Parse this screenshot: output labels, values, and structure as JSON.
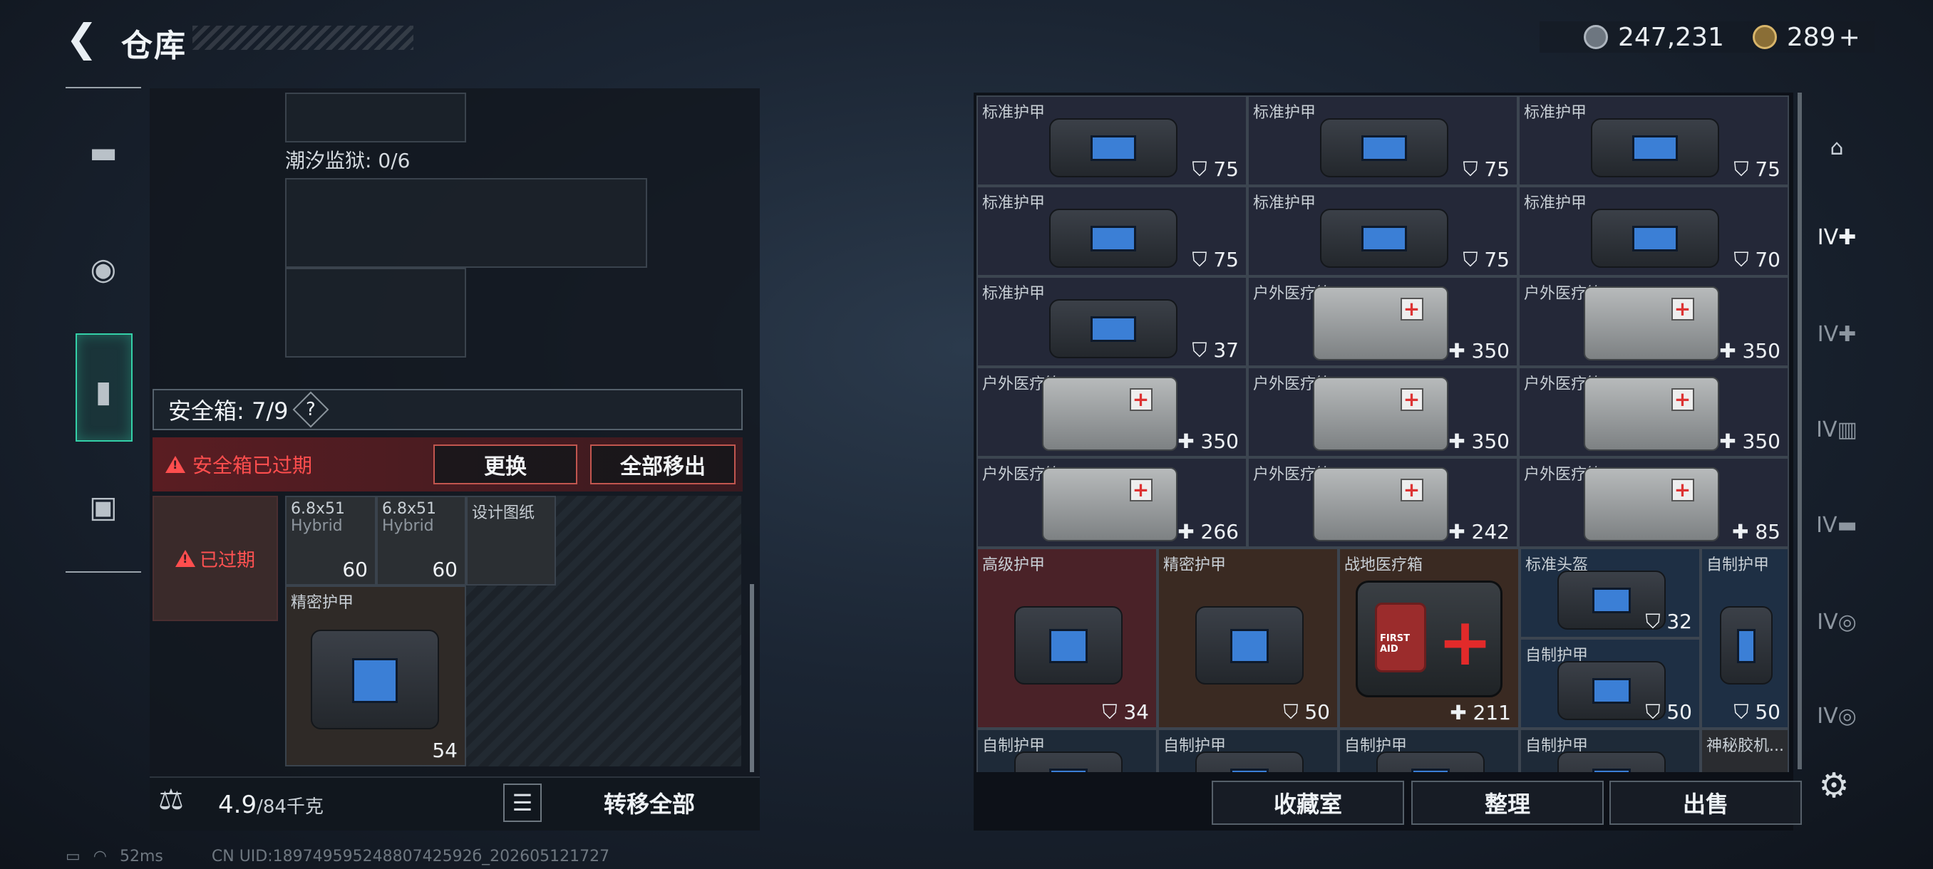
{
  "header": {
    "back_icon": "back-arrow-icon",
    "title": "仓库"
  },
  "currency": {
    "coins": "247,231",
    "premium": "289",
    "premium_plus": "+"
  },
  "left_nav": {
    "items": [
      "weapon-icon",
      "armor-icon",
      "safebox-icon",
      "toolbox-icon"
    ],
    "active": "safebox-icon"
  },
  "prison": {
    "label": "潮汐监狱: 0/6"
  },
  "safebox": {
    "label": "安全箱: 7/9",
    "help": "?",
    "expired_text": "安全箱已过期",
    "replace_label": "更换",
    "remove_all_label": "全部移出",
    "badge_text": "已过期",
    "items": [
      {
        "name": "6.8x51",
        "tag": "Hybrid",
        "count": "60"
      },
      {
        "name": "6.8x51",
        "tag": "Hybrid",
        "count": "60"
      },
      {
        "name": "设计图纸",
        "tag": "",
        "count": ""
      },
      {
        "name": "精密护甲",
        "tag": "",
        "count": "54"
      }
    ]
  },
  "weight": {
    "value": "4.9",
    "unit": "/84千克"
  },
  "transfer_all_label": "转移全部",
  "status": {
    "ping": "52ms",
    "uid": "CN UID:18974959524880742592б_202605121727"
  },
  "stash": {
    "items": [
      {
        "name": "标准护甲",
        "value": "75",
        "kind": "armor"
      },
      {
        "name": "标准护甲",
        "value": "75",
        "kind": "armor"
      },
      {
        "name": "标准护甲",
        "value": "75",
        "kind": "armor"
      },
      {
        "name": "标准护甲",
        "value": "75",
        "kind": "armor"
      },
      {
        "name": "标准护甲",
        "value": "75",
        "kind": "armor"
      },
      {
        "name": "标准护甲",
        "value": "70",
        "kind": "armor"
      },
      {
        "name": "标准护甲",
        "value": "37",
        "kind": "armor"
      },
      {
        "name": "户外医疗箱",
        "value": "350",
        "kind": "medkit"
      },
      {
        "name": "户外医疗箱",
        "value": "350",
        "kind": "medkit"
      },
      {
        "name": "户外医疗箱",
        "value": "350",
        "kind": "medkit"
      },
      {
        "name": "户外医疗箱",
        "value": "350",
        "kind": "medkit"
      },
      {
        "name": "户外医疗箱",
        "value": "350",
        "kind": "medkit"
      },
      {
        "name": "户外医疗箱",
        "value": "266",
        "kind": "medkit"
      },
      {
        "name": "户外医疗箱",
        "value": "242",
        "kind": "medkit"
      },
      {
        "name": "户外医疗箱",
        "value": "85",
        "kind": "medkit"
      },
      {
        "name": "高级护甲",
        "value": "34",
        "kind": "armor"
      },
      {
        "name": "精密护甲",
        "value": "50",
        "kind": "armor"
      },
      {
        "name": "战地医疗箱",
        "value": "211",
        "kind": "firstaid"
      },
      {
        "name": "标准头盔",
        "value": "32",
        "kind": "helmet"
      },
      {
        "name": "自制护甲",
        "value": "50",
        "kind": "armor"
      },
      {
        "name": "自制护甲",
        "value": "50",
        "kind": "armor"
      },
      {
        "name": "自制护甲",
        "value": "",
        "kind": "armor"
      },
      {
        "name": "自制护甲",
        "value": "",
        "kind": "armor"
      },
      {
        "name": "自制护甲",
        "value": "",
        "kind": "armor"
      },
      {
        "name": "自制护甲",
        "value": "",
        "kind": "armor"
      },
      {
        "name": "神秘胶机...",
        "value": "",
        "kind": "misc"
      }
    ]
  },
  "first_aid_label": "FIRST AID",
  "filters": {
    "tier": "IV"
  },
  "footer": {
    "collection_label": "收藏室",
    "sort_label": "整理",
    "sell_label": "出售"
  }
}
